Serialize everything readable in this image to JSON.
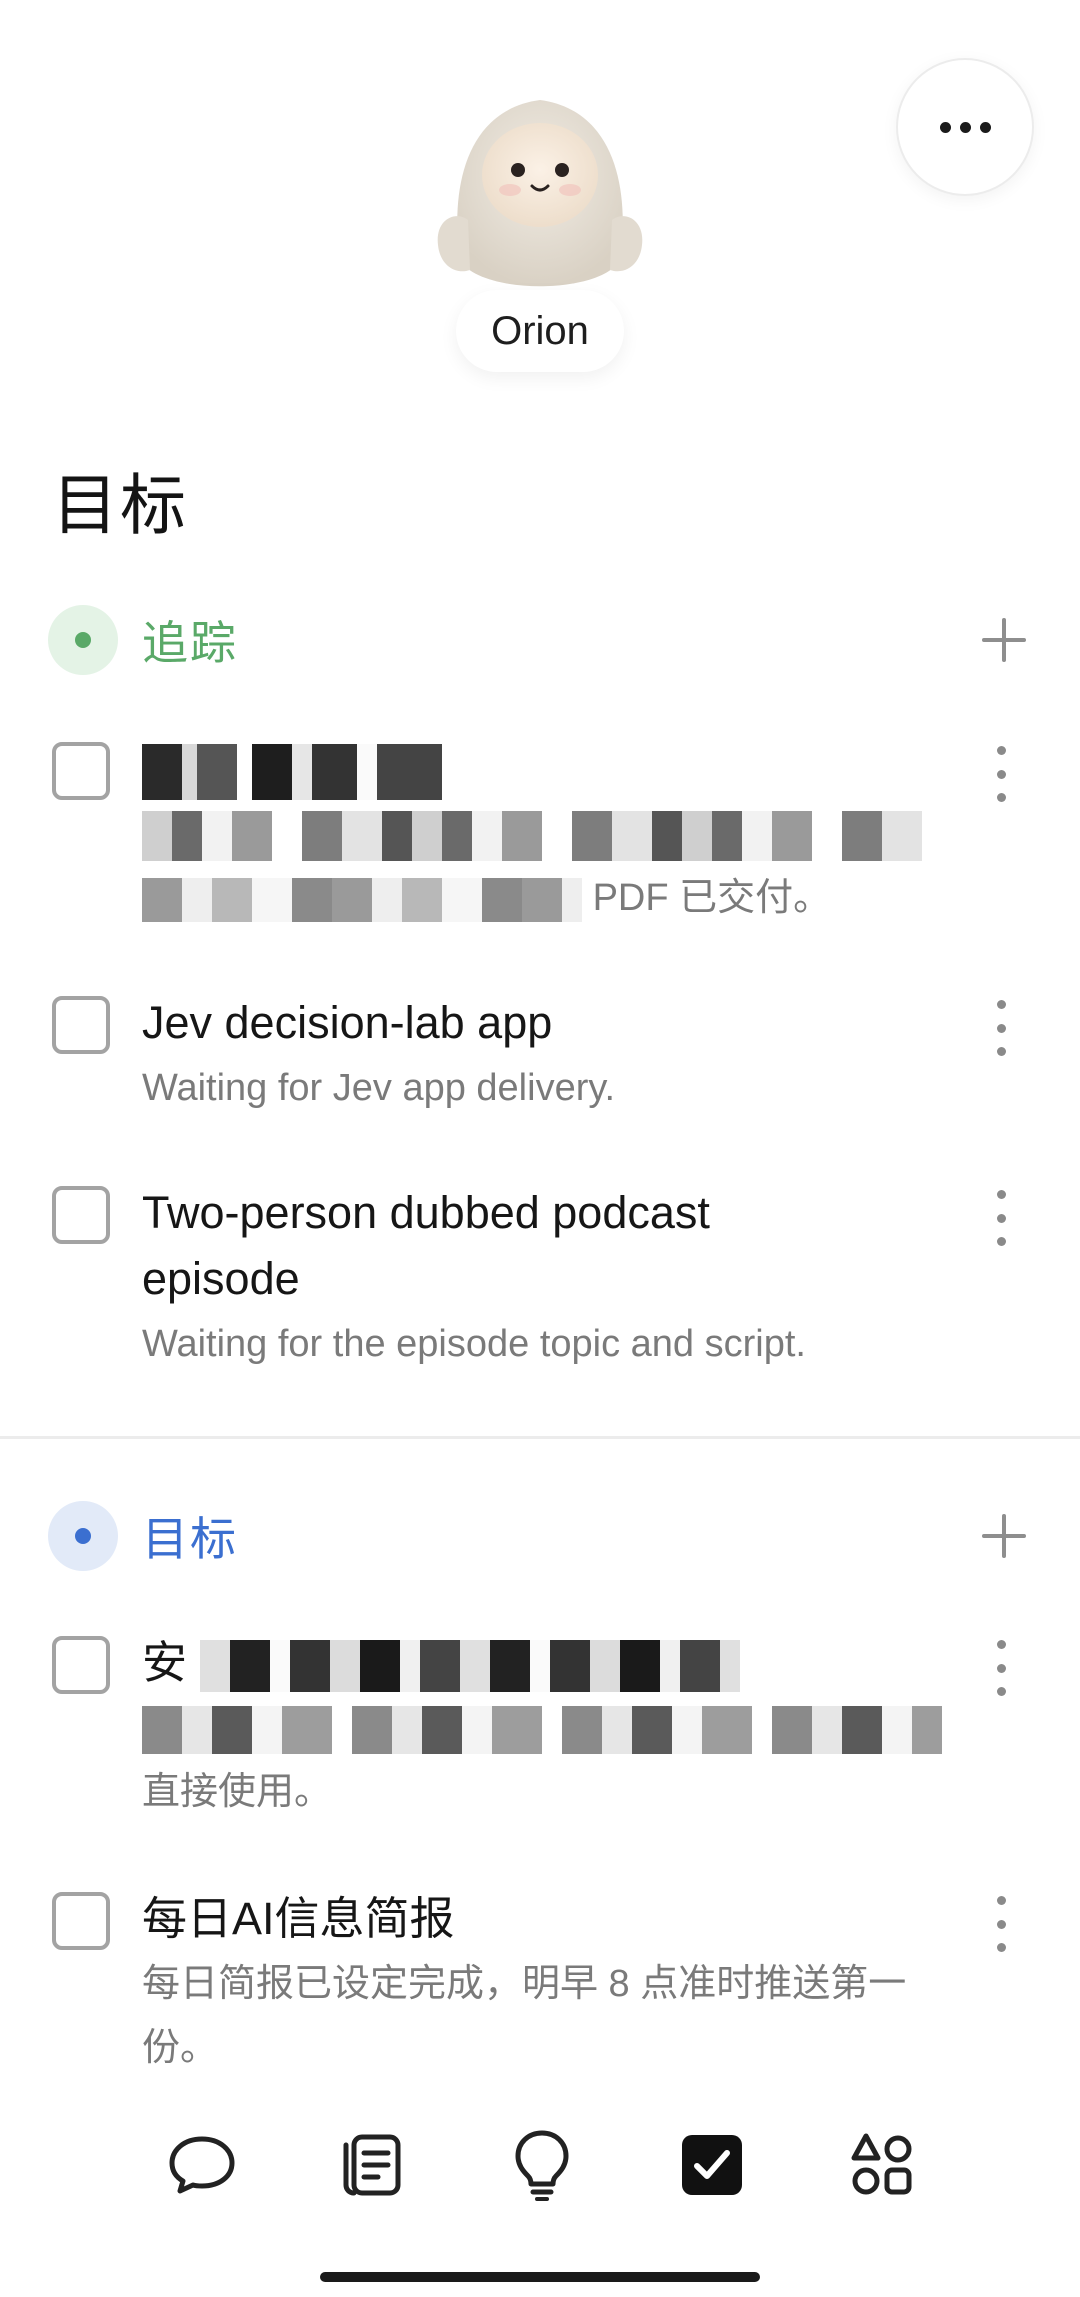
{
  "header": {
    "agent_name": "Orion",
    "avatar_icon": "plush-character-avatar",
    "more_icon": "more-horizontal-icon"
  },
  "page": {
    "title": "目标"
  },
  "colors": {
    "tracking_accent": "#5aa968",
    "tracking_bg": "#e4f3e6",
    "goals_accent": "#3b6fd0",
    "goals_bg": "#e2eaf8",
    "active_nav": "#111111"
  },
  "sections": [
    {
      "label": "追踪",
      "tasks": [
        {
          "title": "",
          "subtitle_line2": "PDF 已交付。",
          "redacted": true
        },
        {
          "title": "Jev decision-lab app",
          "subtitle": "Waiting for Jev app delivery."
        },
        {
          "title": "Two-person dubbed podcast episode",
          "subtitle": "Waiting for the episode topic and script."
        }
      ]
    },
    {
      "label": "目标",
      "tasks": [
        {
          "title": "安",
          "subtitle_line2": "直接使用。",
          "redacted": true
        },
        {
          "title": "每日AI信息简报",
          "subtitle": "每日简报已设定完成，明早 8 点准时推送第一份。"
        }
      ]
    }
  ],
  "bottom_nav": [
    {
      "icon": "chat-bubble-icon",
      "active": false
    },
    {
      "icon": "notes-icon",
      "active": false
    },
    {
      "icon": "lightbulb-icon",
      "active": false
    },
    {
      "icon": "checkbox-checked-icon",
      "active": true
    },
    {
      "icon": "apps-shapes-icon",
      "active": false
    }
  ]
}
